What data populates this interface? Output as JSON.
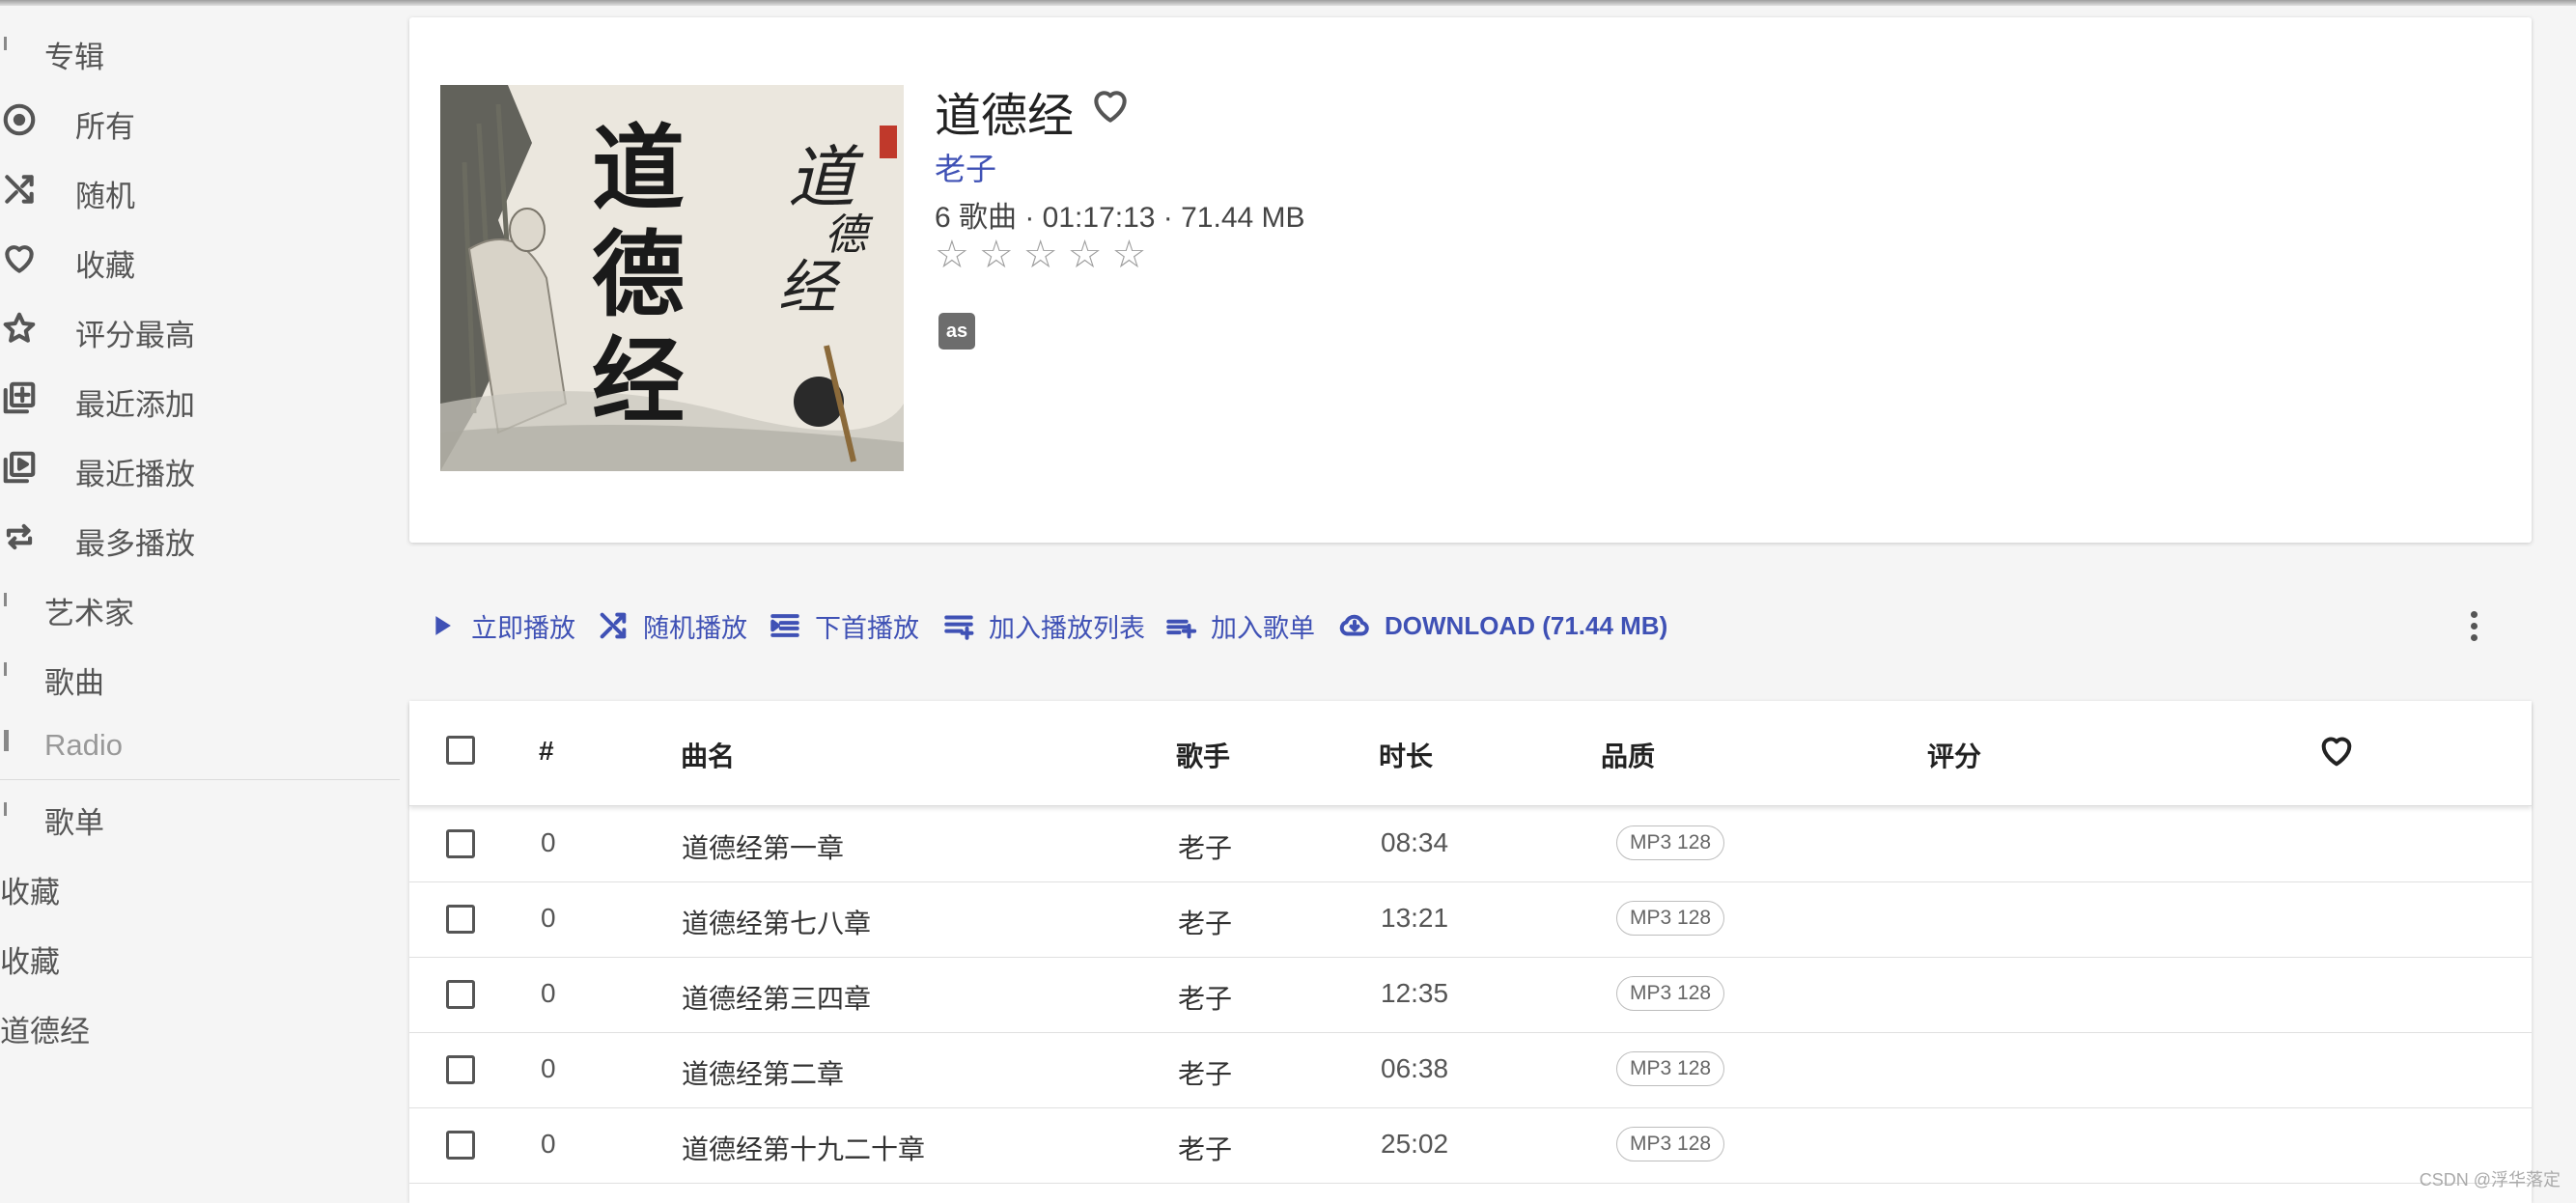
{
  "sidebar": {
    "albums_section": "专辑",
    "items": [
      {
        "label": "所有",
        "icon": "album-disc-icon"
      },
      {
        "label": "随机",
        "icon": "shuffle-icon"
      },
      {
        "label": "收藏",
        "icon": "heart-icon"
      },
      {
        "label": "评分最高",
        "icon": "star-icon"
      },
      {
        "label": "最近添加",
        "icon": "library-add-icon"
      },
      {
        "label": "最近播放",
        "icon": "video-library-icon"
      },
      {
        "label": "最多播放",
        "icon": "repeat-icon"
      }
    ],
    "artists_section": "艺术家",
    "songs_section": "歌曲",
    "radio_section": "Radio",
    "playlists_section": "歌单",
    "playlists": [
      "收藏",
      "收藏",
      "道德经"
    ]
  },
  "album": {
    "title": "道德经",
    "artist": "老子",
    "meta": "6 歌曲 · 01:17:13 · 71.44 MB",
    "rating": 0,
    "max_rating": 5,
    "lastfm_label": "as",
    "cover_text_main": [
      "道",
      "德",
      "经"
    ],
    "cover_text_side": [
      "道",
      "德",
      "经"
    ]
  },
  "toolbar": {
    "play_now": "立即播放",
    "shuffle_play": "随机播放",
    "play_next": "下首播放",
    "add_to_queue": "加入播放列表",
    "add_to_playlist": "加入歌单",
    "download": "DOWNLOAD (71.44 MB)"
  },
  "table": {
    "headers": {
      "num": "#",
      "title": "曲名",
      "artist": "歌手",
      "duration": "时长",
      "quality": "品质",
      "rating": "评分"
    },
    "rows": [
      {
        "num": "0",
        "title": "道德经第一章",
        "artist": "老子",
        "duration": "08:34",
        "quality": "MP3 128"
      },
      {
        "num": "0",
        "title": "道德经第七八章",
        "artist": "老子",
        "duration": "13:21",
        "quality": "MP3 128"
      },
      {
        "num": "0",
        "title": "道德经第三四章",
        "artist": "老子",
        "duration": "12:35",
        "quality": "MP3 128"
      },
      {
        "num": "0",
        "title": "道德经第二章",
        "artist": "老子",
        "duration": "06:38",
        "quality": "MP3 128"
      },
      {
        "num": "0",
        "title": "道德经第十九二十章",
        "artist": "老子",
        "duration": "25:02",
        "quality": "MP3 128"
      }
    ]
  },
  "watermark": "CSDN @浮华落定",
  "colors": {
    "accent": "#3f51b5",
    "background": "#f5f5f5",
    "card": "#ffffff",
    "icon": "#555555"
  }
}
